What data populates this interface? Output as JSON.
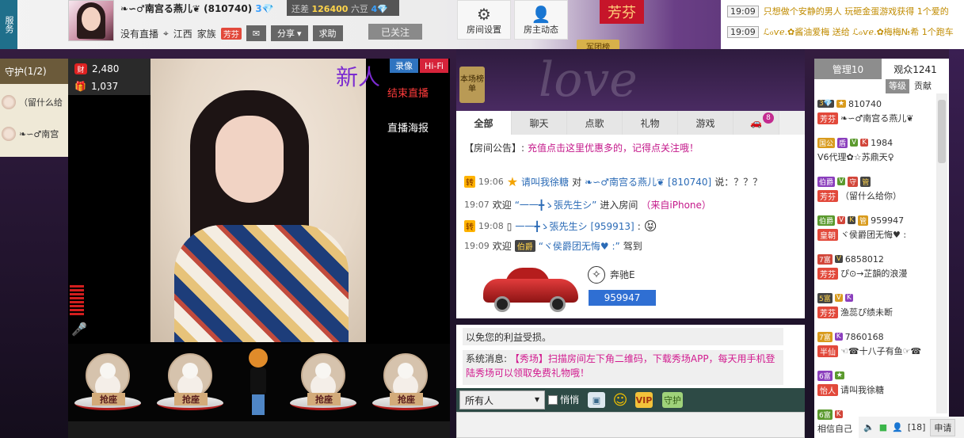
{
  "service_tab": "服务",
  "host": {
    "name": "❧∽♂南宫る燕儿❦",
    "id": "(810740)",
    "diamond_level": "3",
    "diff_label": "还差",
    "diff_value": "126400",
    "diff_unit": "六豆",
    "next_level": "4",
    "live_status": "没有直播",
    "location": "江西",
    "family_label": "家族",
    "family_badge": "芳芬",
    "share_label": "分享",
    "ask_label": "求助",
    "follow_label": "已关注"
  },
  "top_buttons": {
    "room_settings": "房间设置",
    "host_news": "房主动态",
    "fan_badge": "芳芬",
    "army_list": "军团榜"
  },
  "ticker": [
    {
      "time": "19:09",
      "text": "只想做个安静的男人 玩砸金蛋游戏获得 1个爱的"
    },
    {
      "time": "19:09",
      "text": "ℒℴѵℯ.✿酱油爱梅 送给 ℒℴѵℯ.✿梅梅№希 1个跑车"
    }
  ],
  "guard": {
    "title": "守护",
    "count": "(1/2)",
    "rows": [
      {
        "name": "（留什么给"
      },
      {
        "name": "❧∽♂南宫"
      }
    ]
  },
  "video": {
    "wealth_icon": "财",
    "wealth_value": "2,480",
    "gift_value": "1,037",
    "newbie_label": "新人",
    "record_label": "录像",
    "hifi_label": "Hi-Fi",
    "end_live": "结束直播",
    "live_poster": "直播海报"
  },
  "seats": [
    {
      "label": "抢座"
    },
    {
      "label": "抢座"
    },
    {
      "label": "抢座"
    },
    {
      "label": "抢座"
    }
  ],
  "chat": {
    "rank_tag": "本场榜单",
    "header_deco": "love",
    "tabs": [
      "全部",
      "聊天",
      "点歌",
      "礼物",
      "游戏"
    ],
    "car_count": "8",
    "announcement_label": "【房间公告】:",
    "announcement_text": "充值点击这里优惠多的，记得点关注哦！",
    "messages": [
      {
        "tag": "转",
        "time": "19:06",
        "from": "请叫我徐糖",
        "verb": "对",
        "to": "❧∽♂南宫る燕儿❦",
        "to_id": "[810740]",
        "suffix": "说：？？？"
      },
      {
        "time": "19:07",
        "prefix": "欢迎",
        "name": "“一一╋ゝ張先生シ”",
        "action": "进入房间",
        "extra": "（来自iPhone）"
      },
      {
        "tag": "转",
        "time": "19:08",
        "name": "一一╋ゝ張先生シ",
        "id": "[959913]",
        "suffix": ":"
      },
      {
        "time": "19:09",
        "prefix": "欢迎",
        "badge": "伯爵",
        "name": "“ヾ侯爵团无悔♥ :”",
        "action": "驾到"
      }
    ],
    "car_name": "奔驰E",
    "car_id": "959947",
    "sys_line1": "以免您的利益受损。",
    "sys_label": "系统消息:",
    "sys_text": "【秀场】扫描房间左下角二维码，下载秀场APP，每天用手机登陆秀场可以领取免费礼物哦！",
    "recipient": "所有人",
    "whisper": "悄悄",
    "vip_label": "VIP",
    "guard_label": "守护"
  },
  "users": {
    "tab_admin": "管理10",
    "tab_audience": "观众1241",
    "sort_level": "等级",
    "sort_contrib": "贡献",
    "rows": [
      {
        "l1_badges": [
          "3💎",
          "★"
        ],
        "l1_text": "810740",
        "l2_badge": "芳芬",
        "l2_text": "❧∽♂南宫る燕儿❦"
      },
      {
        "l1_badges": [
          "国公",
          "盾",
          "V",
          "K"
        ],
        "l1_text": "1984",
        "l2_badge": "",
        "l2_text": "V6代理✿☆苏鼎天♀"
      },
      {
        "l1_badges": [
          "伯爵",
          "V",
          "守",
          "管"
        ],
        "l1_text": "",
        "l2_badge": "芳芬",
        "l2_text": "（留什么给你）"
      },
      {
        "l1_badges": [
          "伯爵",
          "V",
          "K",
          "管"
        ],
        "l1_text": "959947",
        "l2_badge": "皇朝",
        "l2_text": "ヾ侯爵团无悔♥ :"
      },
      {
        "l1_badges": [
          "7富",
          "V"
        ],
        "l1_text": "6858012",
        "l2_badge": "芳芬",
        "l2_text": "ぴ⊙→芷韻的浪漫"
      },
      {
        "l1_badges": [
          "5富",
          "V",
          "K"
        ],
        "l1_text": "",
        "l2_badge": "芳芬",
        "l2_text": "渔蕊ぴ绩未断"
      },
      {
        "l1_badges": [
          "7富",
          "K"
        ],
        "l1_text": "7860168",
        "l2_badge": "半仙",
        "l2_text": "☜☎十八子有鱼☞☎"
      },
      {
        "l1_badges": [
          "6富",
          "★"
        ],
        "l1_text": "",
        "l2_badge": "怡人",
        "l2_text": "请叫我徐糖"
      },
      {
        "l1_badges": [
          "6富",
          "K"
        ],
        "l1_text": "",
        "l2_badge": "",
        "l2_text": "相信自己"
      }
    ],
    "mic_count": "[18]",
    "apply_mic": "申请"
  }
}
